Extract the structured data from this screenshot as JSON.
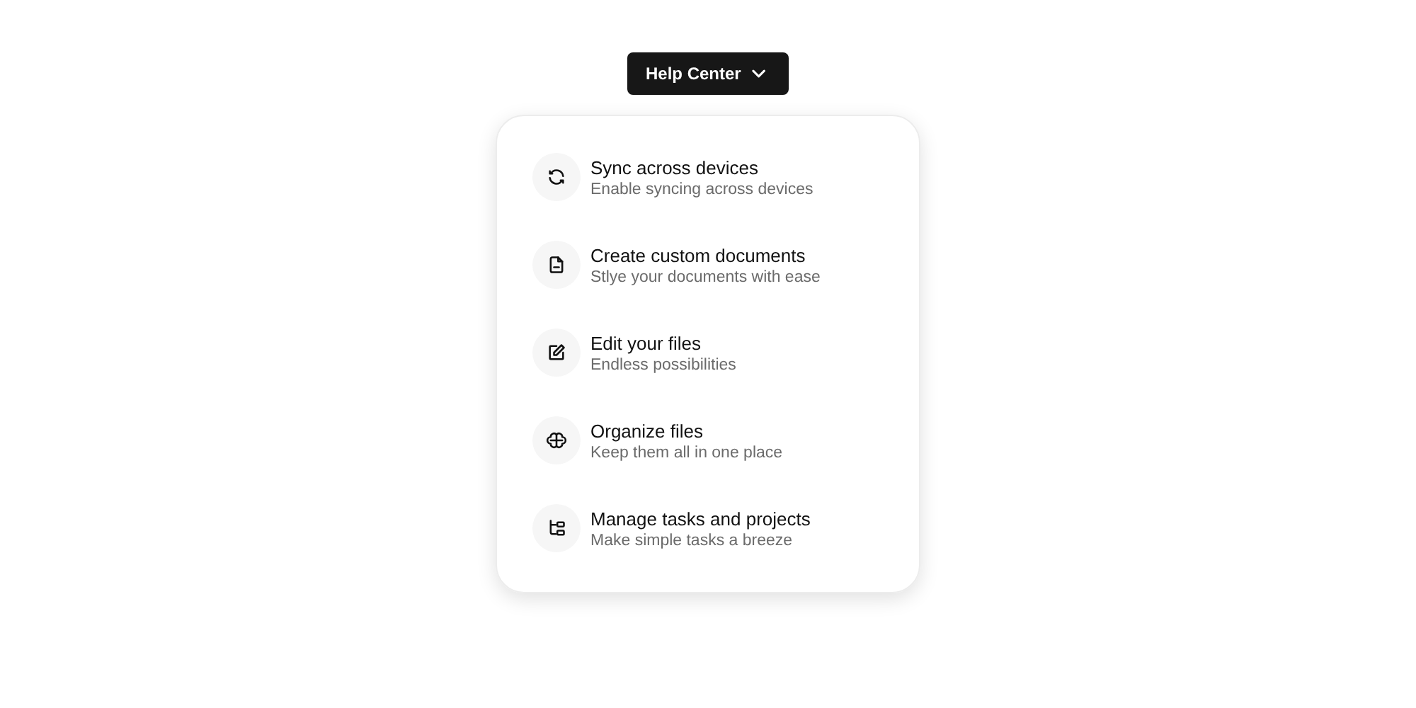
{
  "trigger": {
    "label": "Help Center",
    "expanded": true
  },
  "menu": {
    "items": [
      {
        "kind": "sync",
        "title": "Sync across devices",
        "description": "Enable syncing across devices"
      },
      {
        "kind": "document",
        "title": "Create custom documents",
        "description": "Stlye your documents with ease"
      },
      {
        "kind": "edit",
        "title": "Edit your files",
        "description": "Endless possibilities"
      },
      {
        "kind": "organize",
        "title": "Organize files",
        "description": "Keep them all in one place"
      },
      {
        "kind": "tasks",
        "title": "Manage tasks and projects",
        "description": "Make simple tasks a breeze"
      }
    ]
  }
}
